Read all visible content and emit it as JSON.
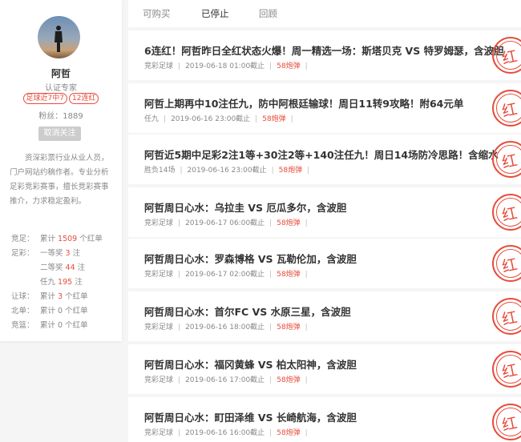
{
  "tabs": [
    {
      "label": "可购买"
    },
    {
      "label": "已停止"
    },
    {
      "label": "回顾"
    }
  ],
  "profile": {
    "name": "阿哲",
    "cert": "认证专家",
    "badges": [
      "足球近7中7",
      "12连红"
    ],
    "fans": "粉丝：1889",
    "unfollow_label": "取消关注",
    "intro": "资深彩票行业从业人员，门户网站约稿作者。专业分析足彩竞彩赛事，擅长竞彩赛事推介，力求稳定盈利。"
  },
  "stats": {
    "jingcai_label": "竞足：",
    "jingcai_pre": "累计",
    "jingcai_count": "1509",
    "jingcai_post": "个红单",
    "zucai_label": "足彩：",
    "zucai_first_pre": "一等奖",
    "zucai_first_count": "3",
    "zucai_first_post": "注",
    "zucai_second_pre": "二等奖",
    "zucai_second_count": "44",
    "zucai_second_post": "注",
    "zucai_renjiu_pre": "任九",
    "zucai_renjiu_count": "195",
    "zucai_renjiu_post": "注",
    "rangqiu_label": "让球：",
    "rangqiu_pre": "累计",
    "rangqiu_count": "3",
    "rangqiu_post": "个红单",
    "beidan_label": "北单：",
    "beidan_text": "累计 0 个红单",
    "jinglan_label": "竞篮：",
    "jinglan_text": "累计 0 个红单"
  },
  "stamp_text": "红",
  "articles": [
    {
      "title": "6连红！阿哲昨日全红状态火爆！周一精选一场：斯塔贝克 VS 特罗姆瑟，含波胆",
      "category": "竞彩足球",
      "date": "2019-06-18 01:00截止",
      "price": "58炮弹"
    },
    {
      "title": "阿哲上期再中10注任九，防中阿根廷输球！周日11转9攻略！附64元单",
      "category": "任九",
      "date": "2019-06-16 23:00截止",
      "price": "58炮弹"
    },
    {
      "title": "阿哲近5期中足彩2注1等+30注2等+140注任九！周日14场防冷思路！含缩水",
      "category": "胜负14场",
      "date": "2019-06-16 23:00截止",
      "price": "58炮弹"
    },
    {
      "title": "阿哲周日心水：乌拉圭 VS 厄瓜多尔，含波胆",
      "category": "竞彩足球",
      "date": "2019-06-17 06:00截止",
      "price": "58炮弹"
    },
    {
      "title": "阿哲周日心水：罗森博格 VS 瓦勒伦加，含波胆",
      "category": "竞彩足球",
      "date": "2019-06-17 02:00截止",
      "price": "58炮弹"
    },
    {
      "title": "阿哲周日心水：首尔FC VS 水原三星，含波胆",
      "category": "竞彩足球",
      "date": "2019-06-16 18:00截止",
      "price": "58炮弹"
    },
    {
      "title": "阿哲周日心水：福冈黄蜂 VS 柏太阳神，含波胆",
      "category": "竞彩足球",
      "date": "2019-06-16 17:00截止",
      "price": "58炮弹"
    },
    {
      "title": "阿哲周日心水：町田泽维 VS 长崎航海，含波胆",
      "category": "竞彩足球",
      "date": "2019-06-16 16:00截止",
      "price": "58炮弹"
    }
  ]
}
